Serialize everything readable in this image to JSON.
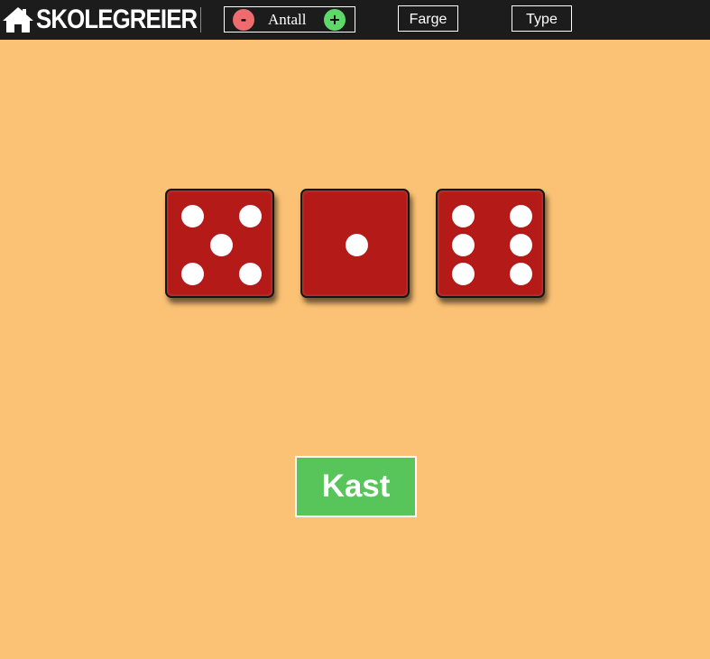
{
  "header": {
    "logo_text": "SKOLEGREIER",
    "logo_icon": "home-icon",
    "counter": {
      "minus_label": "-",
      "label": "Antall",
      "plus_label": "+"
    },
    "menu": [
      {
        "label": "Farge"
      },
      {
        "label": "Type"
      }
    ]
  },
  "dice": [
    {
      "value": 5
    },
    {
      "value": 1
    },
    {
      "value": 6
    }
  ],
  "colors": {
    "background": "#fbc174",
    "die": "#b41a17",
    "pip": "#ffffff",
    "throw_button": "#58c55b",
    "minus": "#ee6b6e",
    "plus": "#5fd86a"
  },
  "throw_button": {
    "label": "Kast"
  }
}
